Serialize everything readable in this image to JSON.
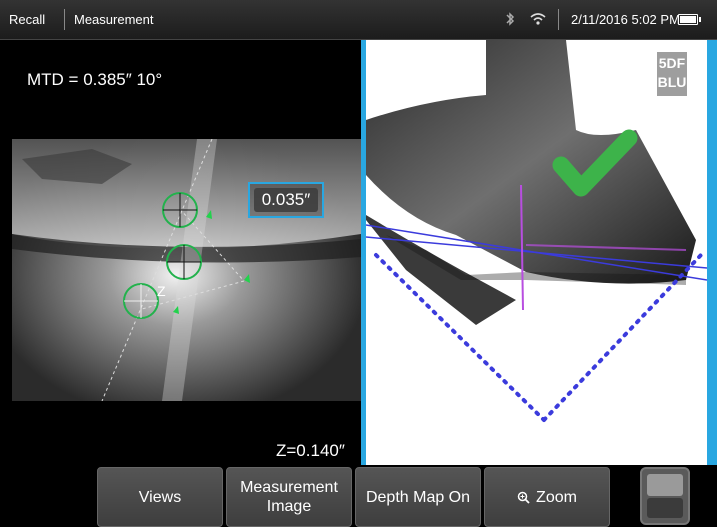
{
  "status_bar": {
    "crumb_1": "Recall",
    "crumb_2": "Measurement",
    "datetime": "2/11/2016 5:02 PM",
    "icons": [
      "bluetooth-icon",
      "wifi-icon",
      "battery-icon"
    ]
  },
  "measurement": {
    "mtd_text": "MTD = 0.385″ 10°",
    "depth_text": "Z=0.140″",
    "readout_value": "0.035″",
    "cursor_z_label": "Z"
  },
  "probe_tag": {
    "line1": "5DF",
    "line2": "BLU"
  },
  "softkeys": {
    "views": "Views",
    "measurement_image_line1": "Measurement",
    "measurement_image_line2": "Image",
    "depth_map": "Depth Map On",
    "zoom": "Zoom"
  },
  "colors": {
    "accent_blue": "#29a7e1",
    "check_green": "#3db34a",
    "cursor_green": "#22b24c",
    "plane_blue": "#3b3bdc",
    "plane_magenta": "#b84ee0"
  }
}
